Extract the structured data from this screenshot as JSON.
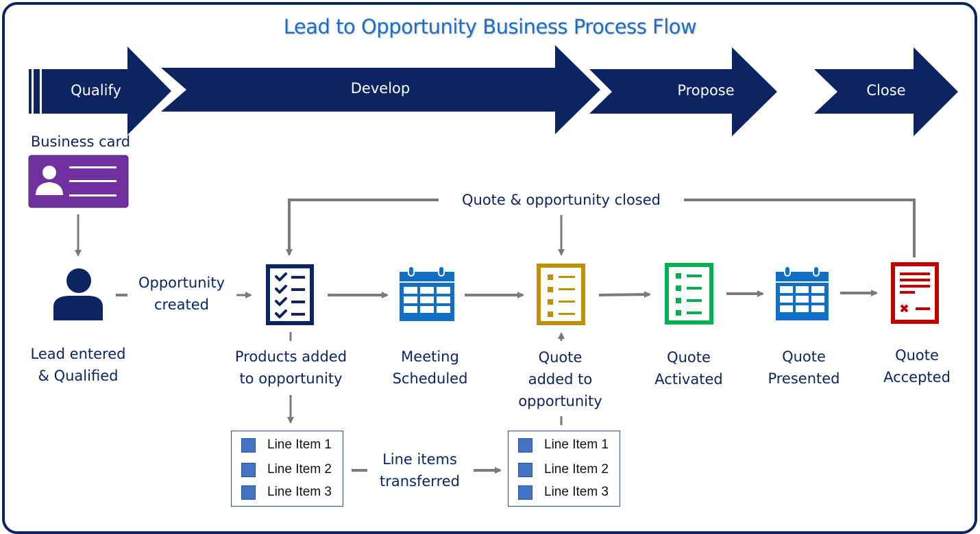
{
  "title": "Lead to Opportunity Business Process Flow",
  "colors": {
    "navy": "#0c2461",
    "title_blue": "#1a6fc4",
    "connector_gray": "#7a7a7a",
    "purple": "#7030a0",
    "calendar_blue": "#1170c6",
    "gold": "#c09000",
    "green": "#00b050",
    "red": "#c00000",
    "line_item_blue": "#4472c4"
  },
  "stages": [
    {
      "label": "Qualify"
    },
    {
      "label": "Develop"
    },
    {
      "label": "Propose"
    },
    {
      "label": "Close"
    }
  ],
  "business_card": {
    "label": "Business card",
    "icon": "business-card-icon"
  },
  "steps": [
    {
      "id": "lead",
      "icon": "person-icon",
      "line1": "Lead entered",
      "line2": "& Qualified"
    },
    {
      "id": "products",
      "icon": "checklist-icon",
      "line1": "Products added",
      "line2": "to opportunity"
    },
    {
      "id": "meeting",
      "icon": "calendar-icon",
      "line1": "Meeting",
      "line2": "Scheduled"
    },
    {
      "id": "quote-added",
      "icon": "quote-document-icon",
      "line1": "Quote",
      "line2": "added to",
      "line3": "opportunity"
    },
    {
      "id": "quote-activated",
      "icon": "quote-document-icon",
      "line1": "Quote",
      "line2": "Activated"
    },
    {
      "id": "quote-presented",
      "icon": "calendar-icon",
      "line1": "Quote",
      "line2": "Presented"
    },
    {
      "id": "quote-accepted",
      "icon": "signed-document-icon",
      "line1": "Quote",
      "line2": "Accepted"
    }
  ],
  "connectors": {
    "opportunity_created": {
      "line1": "Opportunity",
      "line2": "created"
    },
    "quote_closed": "Quote & opportunity closed",
    "line_items_transferred": {
      "line1": "Line items",
      "line2": "transferred"
    }
  },
  "line_items_left": [
    "Line Item 1",
    "Line Item 2",
    "Line Item 3"
  ],
  "line_items_right": [
    "Line Item 1",
    "Line Item 2",
    "Line Item 3"
  ]
}
